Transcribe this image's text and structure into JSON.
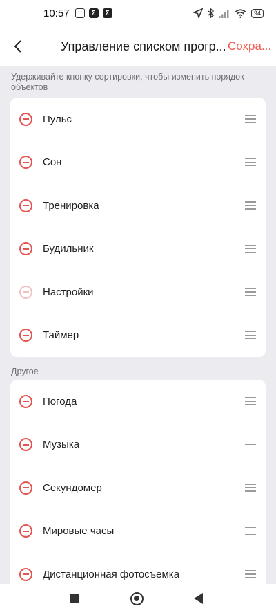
{
  "status_bar": {
    "time": "10:57",
    "app_icons": [
      "notification-icon",
      "sigma-icon",
      "sigma-icon"
    ],
    "battery": "94"
  },
  "header": {
    "title": "Управление списком прогр...",
    "save_label": "Сохра..."
  },
  "hint": "Удерживайте кнопку сортировки, чтобы изменить порядок объектов",
  "enabled_items": [
    {
      "label": "Пульс",
      "removable": true
    },
    {
      "label": "Сон",
      "removable": true
    },
    {
      "label": "Тренировка",
      "removable": true
    },
    {
      "label": "Будильник",
      "removable": true
    },
    {
      "label": "Настройки",
      "removable": false
    },
    {
      "label": "Таймер",
      "removable": true
    }
  ],
  "other_section": {
    "label": "Другое",
    "items": [
      {
        "label": "Погода"
      },
      {
        "label": "Музыка"
      },
      {
        "label": "Секундомер"
      },
      {
        "label": "Мировые часы"
      },
      {
        "label": "Дистанционная фотосъемка"
      }
    ]
  },
  "colors": {
    "accent": "#f05a50",
    "remove": "#e45551",
    "remove_disabled": "#f2c1bf",
    "background": "#ececf0"
  }
}
